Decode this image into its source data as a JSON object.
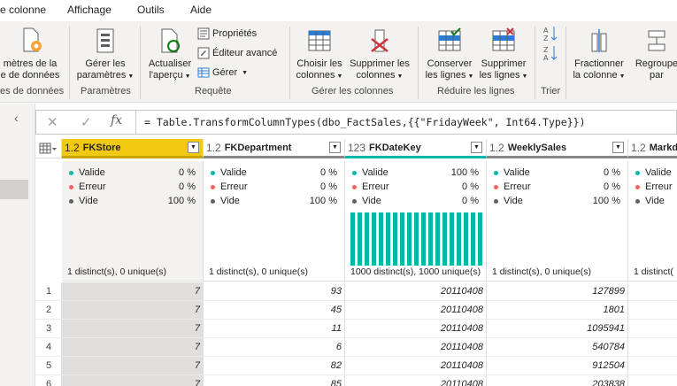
{
  "menu": [
    "e colonne",
    "Affichage",
    "Outils",
    "Aide"
  ],
  "ribbon": {
    "source": {
      "line1": "mètres de la",
      "line2": "e de données",
      "group": "es de données"
    },
    "params": {
      "line1": "Gérer les",
      "line2": "paramètres",
      "group": "Paramètres"
    },
    "refresh": {
      "line1": "Actualiser",
      "line2": "l'aperçu"
    },
    "properties": "Propriétés",
    "advanced_editor": "Éditeur avancé",
    "manage": "Gérer",
    "query_group": "Requête",
    "choose_cols": {
      "line1": "Choisir les",
      "line2": "colonnes"
    },
    "remove_cols": {
      "line1": "Supprimer les",
      "line2": "colonnes"
    },
    "cols_group": "Gérer les colonnes",
    "keep_rows": {
      "line1": "Conserver",
      "line2": "les lignes"
    },
    "remove_rows": {
      "line1": "Supprimer",
      "line2": "les lignes"
    },
    "rows_group": "Réduire les lignes",
    "sort_group": "Trier",
    "split_col": {
      "line1": "Fractionner",
      "line2": "la colonne"
    },
    "group_by": {
      "line1": "Regroupe",
      "line2": "par"
    }
  },
  "formula_bar": {
    "fx": "fx",
    "formula": "= Table.TransformColumnTypes(dbo_FactSales,{{\"FridayWeek\", Int64.Type}})"
  },
  "quality_labels": {
    "valid": "Valide",
    "error": "Erreur",
    "empty": "Vide"
  },
  "colors": {
    "valid": "#01b8aa",
    "error": "#fd625e",
    "empty": "#605e5c",
    "accent": "#f2c811"
  },
  "columns": [
    {
      "type": "1.2",
      "name": "FKStore",
      "valid": "0 %",
      "error": "0 %",
      "empty": "100 %",
      "distinct": "1 distinct(s), 0 unique(s)"
    },
    {
      "type": "1.2",
      "name": "FKDepartment",
      "valid": "0 %",
      "error": "0 %",
      "empty": "100 %",
      "distinct": "1 distinct(s), 0 unique(s)"
    },
    {
      "type": "123",
      "name": "FKDateKey",
      "valid": "100 %",
      "error": "0 %",
      "empty": "0 %",
      "distinct": "1000 distinct(s), 1000 unique(s)"
    },
    {
      "type": "1.2",
      "name": "WeeklySales",
      "valid": "0 %",
      "error": "0 %",
      "empty": "100 %",
      "distinct": "1 distinct(s), 0 unique(s)"
    },
    {
      "type": "1.2",
      "name": "Markd",
      "valid": "",
      "error": "",
      "empty": "",
      "distinct": "1 distinct("
    }
  ],
  "rows": [
    {
      "num": "1",
      "cells": [
        "7",
        "93",
        "20110408",
        "127899",
        ""
      ]
    },
    {
      "num": "2",
      "cells": [
        "7",
        "45",
        "20110408",
        "1801",
        ""
      ]
    },
    {
      "num": "3",
      "cells": [
        "7",
        "11",
        "20110408",
        "1095941",
        ""
      ]
    },
    {
      "num": "4",
      "cells": [
        "7",
        "6",
        "20110408",
        "540784",
        ""
      ]
    },
    {
      "num": "5",
      "cells": [
        "7",
        "82",
        "20110408",
        "912504",
        ""
      ]
    },
    {
      "num": "6",
      "cells": [
        "7",
        "85",
        "20110408",
        "203838",
        ""
      ]
    }
  ]
}
